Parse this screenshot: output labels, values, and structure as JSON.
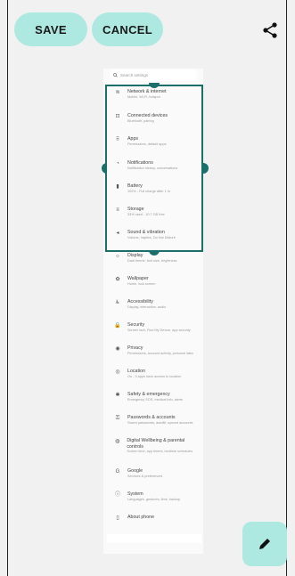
{
  "toolbar": {
    "save_label": "SAVE",
    "cancel_label": "CANCEL",
    "share_icon": "share-icon"
  },
  "preview": {
    "search_placeholder": "Search settings",
    "items": [
      {
        "icon": "≋",
        "title": "Network & internet",
        "subtitle": "Mobile, Wi-Fi, hotspot"
      },
      {
        "icon": "⊡",
        "title": "Connected devices",
        "subtitle": "Bluetooth, pairing"
      },
      {
        "icon": "⠿",
        "title": "Apps",
        "subtitle": "Permissions, default apps"
      },
      {
        "icon": "◔",
        "title": "Notifications",
        "subtitle": "Notification history, conversations"
      },
      {
        "icon": "▮",
        "title": "Battery",
        "subtitle": "100% - Full charge after 1 hr"
      },
      {
        "icon": "≡",
        "title": "Storage",
        "subtitle": "33% used - 10.7 GB free"
      },
      {
        "icon": "◂",
        "title": "Sound & vibration",
        "subtitle": "Volume, haptics, Do Not Disturb"
      },
      {
        "icon": "☼",
        "title": "Display",
        "subtitle": "Dark theme, font size, brightness"
      },
      {
        "icon": "✿",
        "title": "Wallpaper",
        "subtitle": "Home, lock screen"
      },
      {
        "icon": "♿",
        "title": "Accessibility",
        "subtitle": "Display, interaction, audio"
      },
      {
        "icon": "🔒",
        "title": "Security",
        "subtitle": "Screen lock, Find My Device, app security"
      },
      {
        "icon": "◉",
        "title": "Privacy",
        "subtitle": "Permissions, account activity, personal data"
      },
      {
        "icon": "◎",
        "title": "Location",
        "subtitle": "On - 3 apps have access to location"
      },
      {
        "icon": "✱",
        "title": "Safety & emergency",
        "subtitle": "Emergency SOS, medical info, alerts"
      },
      {
        "icon": "⚿",
        "title": "Passwords & accounts",
        "subtitle": "Saved passwords, autofill, synced accounts"
      },
      {
        "icon": "◍",
        "title": "Digital Wellbeing & parental controls",
        "subtitle": "Screen time, app timers, bedtime schedules"
      },
      {
        "icon": "G",
        "title": "Google",
        "subtitle": "Services & preferences"
      },
      {
        "icon": "ⓘ",
        "title": "System",
        "subtitle": "Languages, gestures, time, backup"
      },
      {
        "icon": "▯",
        "title": "About phone",
        "subtitle": ""
      }
    ]
  },
  "fab": {
    "icon": "pencil-icon"
  },
  "colors": {
    "accent": "#aee9e1",
    "crop": "#1b6f6a"
  }
}
